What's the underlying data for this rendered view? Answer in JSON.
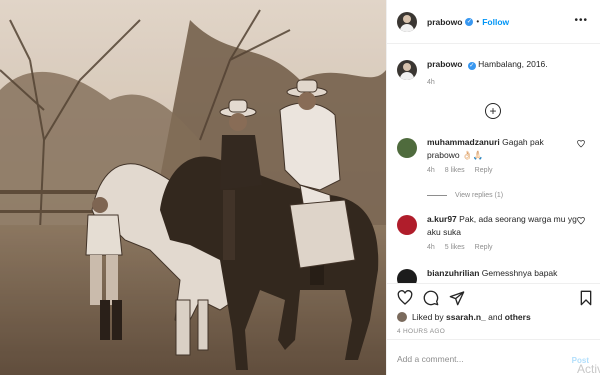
{
  "post": {
    "username": "prabowo",
    "follow_label": "Follow",
    "more_label": "•••",
    "caption_text": "Hambalang, 2016.",
    "caption_time": "4h",
    "load_more_icon": "plus-circle-icon"
  },
  "comments": [
    {
      "user": "muhammadzanuri",
      "text": "Gagah pak prabowo 👌🏻🙏🏻",
      "time": "4h",
      "likes": "8 likes",
      "reply": "Reply",
      "avatar_color": "#4f6b3d"
    },
    {
      "user": "a.kur97",
      "text": "Pak, ada seorang warga mu yg aku suka",
      "time": "4h",
      "likes": "5 likes",
      "reply": "Reply",
      "avatar_color": "#b01d2b"
    },
    {
      "user": "bianzuhrilian",
      "text": "Gemesshnya bapak",
      "avatar_color": "#1c1c1c"
    }
  ],
  "view_replies_label": "View replies (1)",
  "actions": {
    "liked_by_prefix": "Liked by",
    "liked_by_user": "ssarah.n_",
    "liked_by_and": "and",
    "liked_by_others": "others",
    "posted_ago": "4 HOURS AGO"
  },
  "add_comment": {
    "placeholder": "Add a comment...",
    "post_label": "Post",
    "watermark": "Activ"
  },
  "colors": {
    "link": "#0095f6",
    "verified": "#3897f0",
    "muted": "#8e8e8e"
  }
}
